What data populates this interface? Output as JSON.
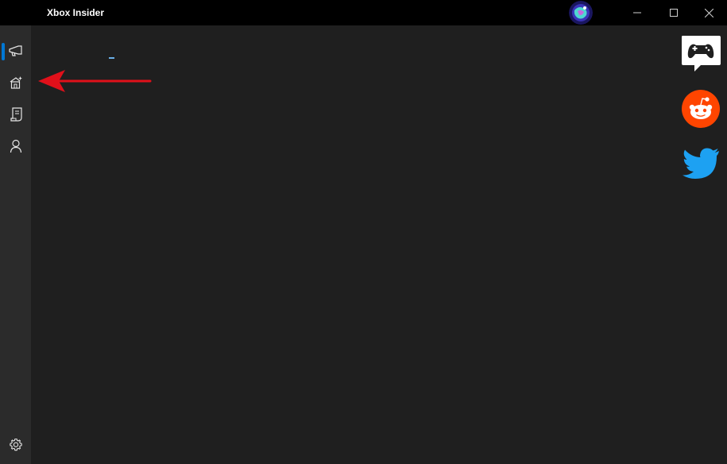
{
  "window": {
    "title": "Xbox Insider",
    "controls": [
      "minimize-icon",
      "maximize-icon",
      "close-icon"
    ]
  },
  "sidebar": {
    "items": [
      {
        "name": "announcements",
        "icon": "megaphone-icon",
        "selected": true
      },
      {
        "name": "insider-content",
        "icon": "house-sparkle-icon",
        "selected": false
      },
      {
        "name": "surveys",
        "icon": "document-icon",
        "selected": false
      },
      {
        "name": "profile",
        "icon": "person-icon",
        "selected": false
      }
    ],
    "footer": {
      "icon": "gear-icon"
    }
  },
  "social_links": [
    {
      "name": "xbox-forums",
      "icon": "controller-chat-icon"
    },
    {
      "name": "reddit",
      "icon": "reddit-icon",
      "color": "#ff4500"
    },
    {
      "name": "twitter",
      "icon": "twitter-icon",
      "color": "#1da1f2"
    }
  ],
  "colors": {
    "accent": "#0078d4",
    "annotation_arrow": "#e0101a"
  }
}
